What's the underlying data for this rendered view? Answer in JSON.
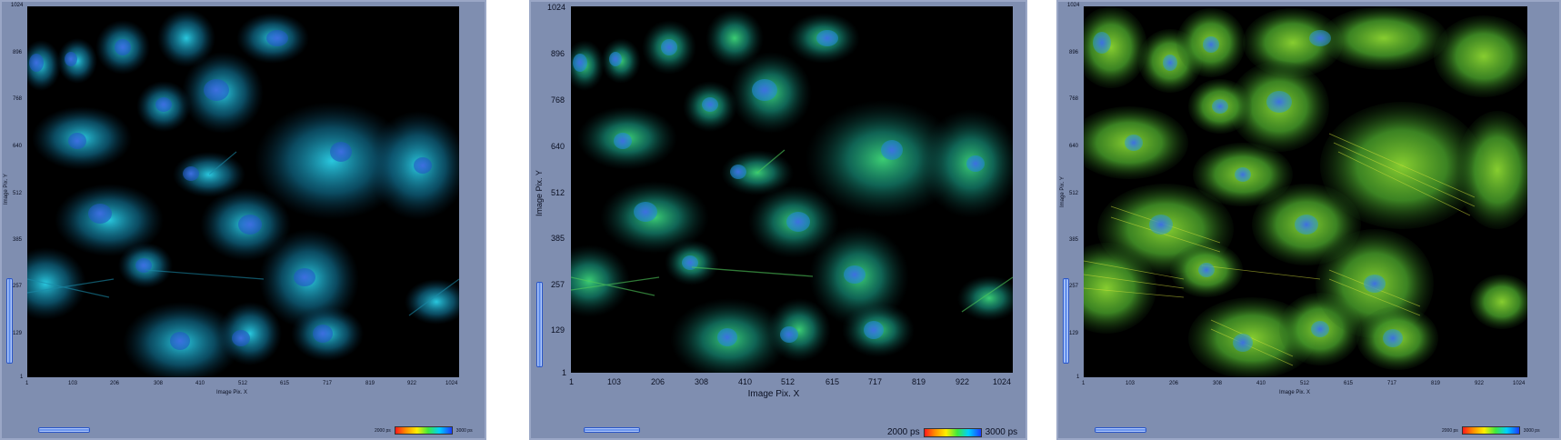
{
  "panels": [
    {
      "id": "left",
      "ylabel": "Image Pix. Y",
      "xlabel": "Image Pix. X",
      "yticks": [
        "1024",
        "896",
        "768",
        "640",
        "512",
        "385",
        "257",
        "129",
        "1"
      ],
      "xticks": [
        "1",
        "103",
        "206",
        "308",
        "410",
        "512",
        "615",
        "717",
        "819",
        "922",
        "1024"
      ],
      "colorbar": {
        "min_label": "2000 ps",
        "max_label": "3000 ps"
      },
      "dominant_colors": [
        "#0e8fb8",
        "#18c6e0",
        "#2a6fd0"
      ]
    },
    {
      "id": "middle",
      "ylabel": "Image Pix. Y",
      "xlabel": "Image Pix. X",
      "yticks": [
        "1024",
        "896",
        "768",
        "640",
        "512",
        "385",
        "257",
        "129",
        "1"
      ],
      "xticks": [
        "1",
        "103",
        "206",
        "308",
        "410",
        "512",
        "615",
        "717",
        "819",
        "922",
        "1024"
      ],
      "colorbar": {
        "min_label": "2000 ps",
        "max_label": "3000 ps"
      },
      "dominant_colors": [
        "#1fa58a",
        "#34d07a",
        "#2a6fd0"
      ]
    },
    {
      "id": "right",
      "ylabel": "Image Pix. Y",
      "xlabel": "Image Pix. X",
      "yticks": [
        "1024",
        "896",
        "768",
        "640",
        "512",
        "385",
        "257",
        "129",
        "1"
      ],
      "xticks": [
        "1",
        "103",
        "206",
        "308",
        "410",
        "512",
        "615",
        "717",
        "819",
        "922",
        "1024"
      ],
      "colorbar": {
        "min_label": "2000 ps",
        "max_label": "3000 ps"
      },
      "dominant_colors": [
        "#7fc82a",
        "#c8d820",
        "#2a6fd0"
      ]
    }
  ]
}
